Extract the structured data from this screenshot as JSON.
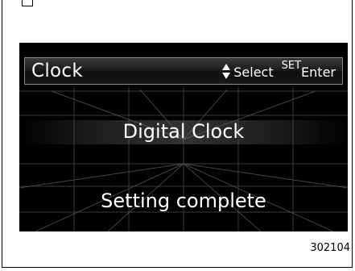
{
  "header": {
    "title": "Clock",
    "select_label": "Select",
    "set_label": "SET",
    "enter_label": "Enter"
  },
  "main": {
    "title": "Digital Clock",
    "status": "Setting complete"
  },
  "figure": {
    "number": "302104"
  },
  "icons": {
    "select_arrows": "up-down-arrows-icon"
  },
  "colors": {
    "screen_background": "#000000",
    "text": "#ffffff",
    "header_border": "#8a8a8a"
  }
}
